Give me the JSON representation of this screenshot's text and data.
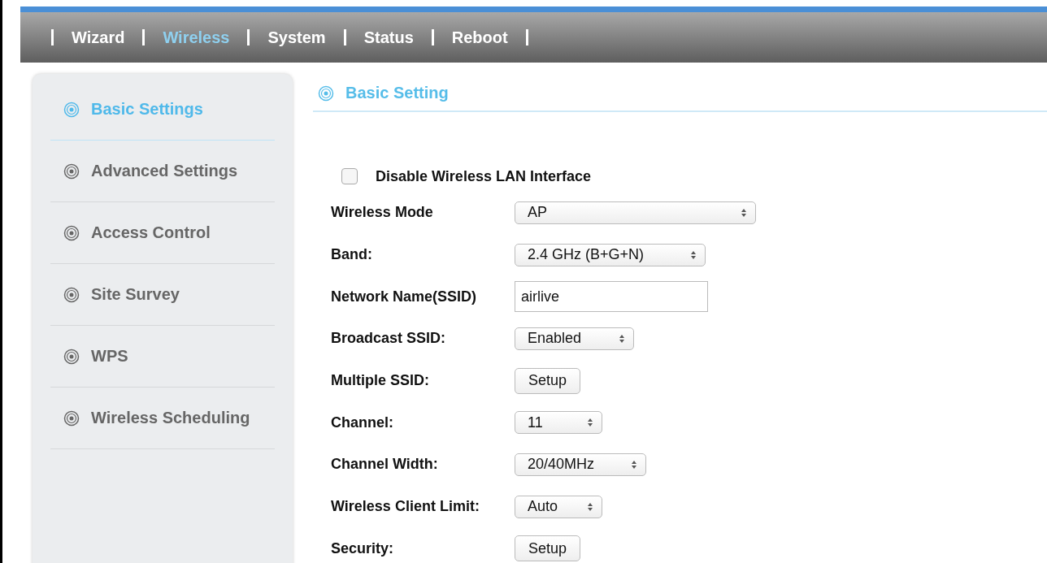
{
  "nav": [
    {
      "label": "Wizard",
      "selected": false
    },
    {
      "label": "Wireless",
      "selected": true
    },
    {
      "label": "System",
      "selected": false
    },
    {
      "label": "Status",
      "selected": false
    },
    {
      "label": "Reboot",
      "selected": false
    }
  ],
  "sidebar": {
    "items": [
      {
        "label": "Basic Settings",
        "selected": true
      },
      {
        "label": "Advanced Settings",
        "selected": false
      },
      {
        "label": "Access Control",
        "selected": false
      },
      {
        "label": "Site Survey",
        "selected": false
      },
      {
        "label": "WPS",
        "selected": false
      },
      {
        "label": "Wireless Scheduling",
        "selected": false
      }
    ]
  },
  "section_title": "Basic Setting",
  "disable_wlan": {
    "label": "Disable Wireless LAN Interface",
    "checked": false
  },
  "fields": [
    {
      "kind": "select",
      "label": "Wireless Mode",
      "value": "AP"
    },
    {
      "kind": "select",
      "label": "Band:",
      "value": "2.4 GHz (B+G+N)"
    },
    {
      "kind": "input",
      "label": "Network Name(SSID)",
      "value": "airlive"
    },
    {
      "kind": "select",
      "label": "Broadcast SSID:",
      "value": "Enabled"
    },
    {
      "kind": "button",
      "label": "Multiple SSID:",
      "value": "Setup"
    },
    {
      "kind": "select",
      "label": "Channel:",
      "value": "11"
    },
    {
      "kind": "select",
      "label": "Channel Width:",
      "value": "20/40MHz"
    },
    {
      "kind": "select",
      "label": "Wireless Client Limit:",
      "value": "Auto"
    },
    {
      "kind": "button",
      "label": "Security:",
      "value": "Setup"
    }
  ]
}
